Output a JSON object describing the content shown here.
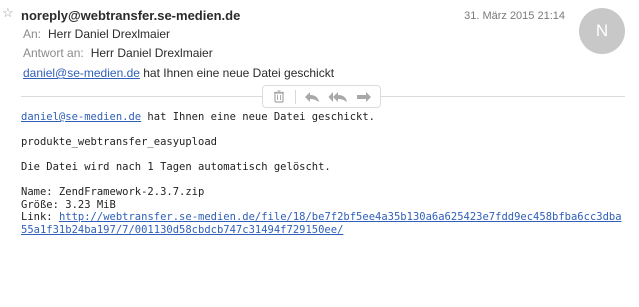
{
  "header": {
    "star_icon": "star-outline-icon",
    "sender": "noreply@webtransfer.se-medien.de",
    "date": "31. März 2015 21:14",
    "avatar_initial": "N",
    "to_label": "An:",
    "to_value": "Herr Daniel Drexlmaier",
    "reply_label": "Antwort an:",
    "reply_value": "Herr Daniel Drexlmaier",
    "summary_link": "daniel@se-medien.de",
    "summary_text": " hat Ihnen eine neue Datei geschickt"
  },
  "toolbar": {
    "icons": [
      "trash-icon",
      "reply-icon",
      "reply-all-icon",
      "forward-icon"
    ]
  },
  "body": {
    "line1_link": "daniel@se-medien.de",
    "line1_text": " hat Ihnen eine neue Datei geschickt.",
    "line2": "produkte_webtransfer_easyupload",
    "line3": "Die Datei wird nach 1 Tagen automatisch gelöscht.",
    "name_line": "Name: ZendFramework-2.3.7.zip",
    "size_line": "Größe: 3.23 MiB",
    "link_label": "Link: ",
    "link_url": "http://webtransfer.se-medien.de/file/18/be7f2bf5ee4a35b130a6a625423e7fdd9ec458bfba6cc3dba55a1f31b24ba197/7/001130d58cbdcb747c31494f729150ee/"
  },
  "colors": {
    "link": "#2f5fb8",
    "avatar_bg": "#c8c8c8",
    "label_gray": "#8a8a8a"
  }
}
